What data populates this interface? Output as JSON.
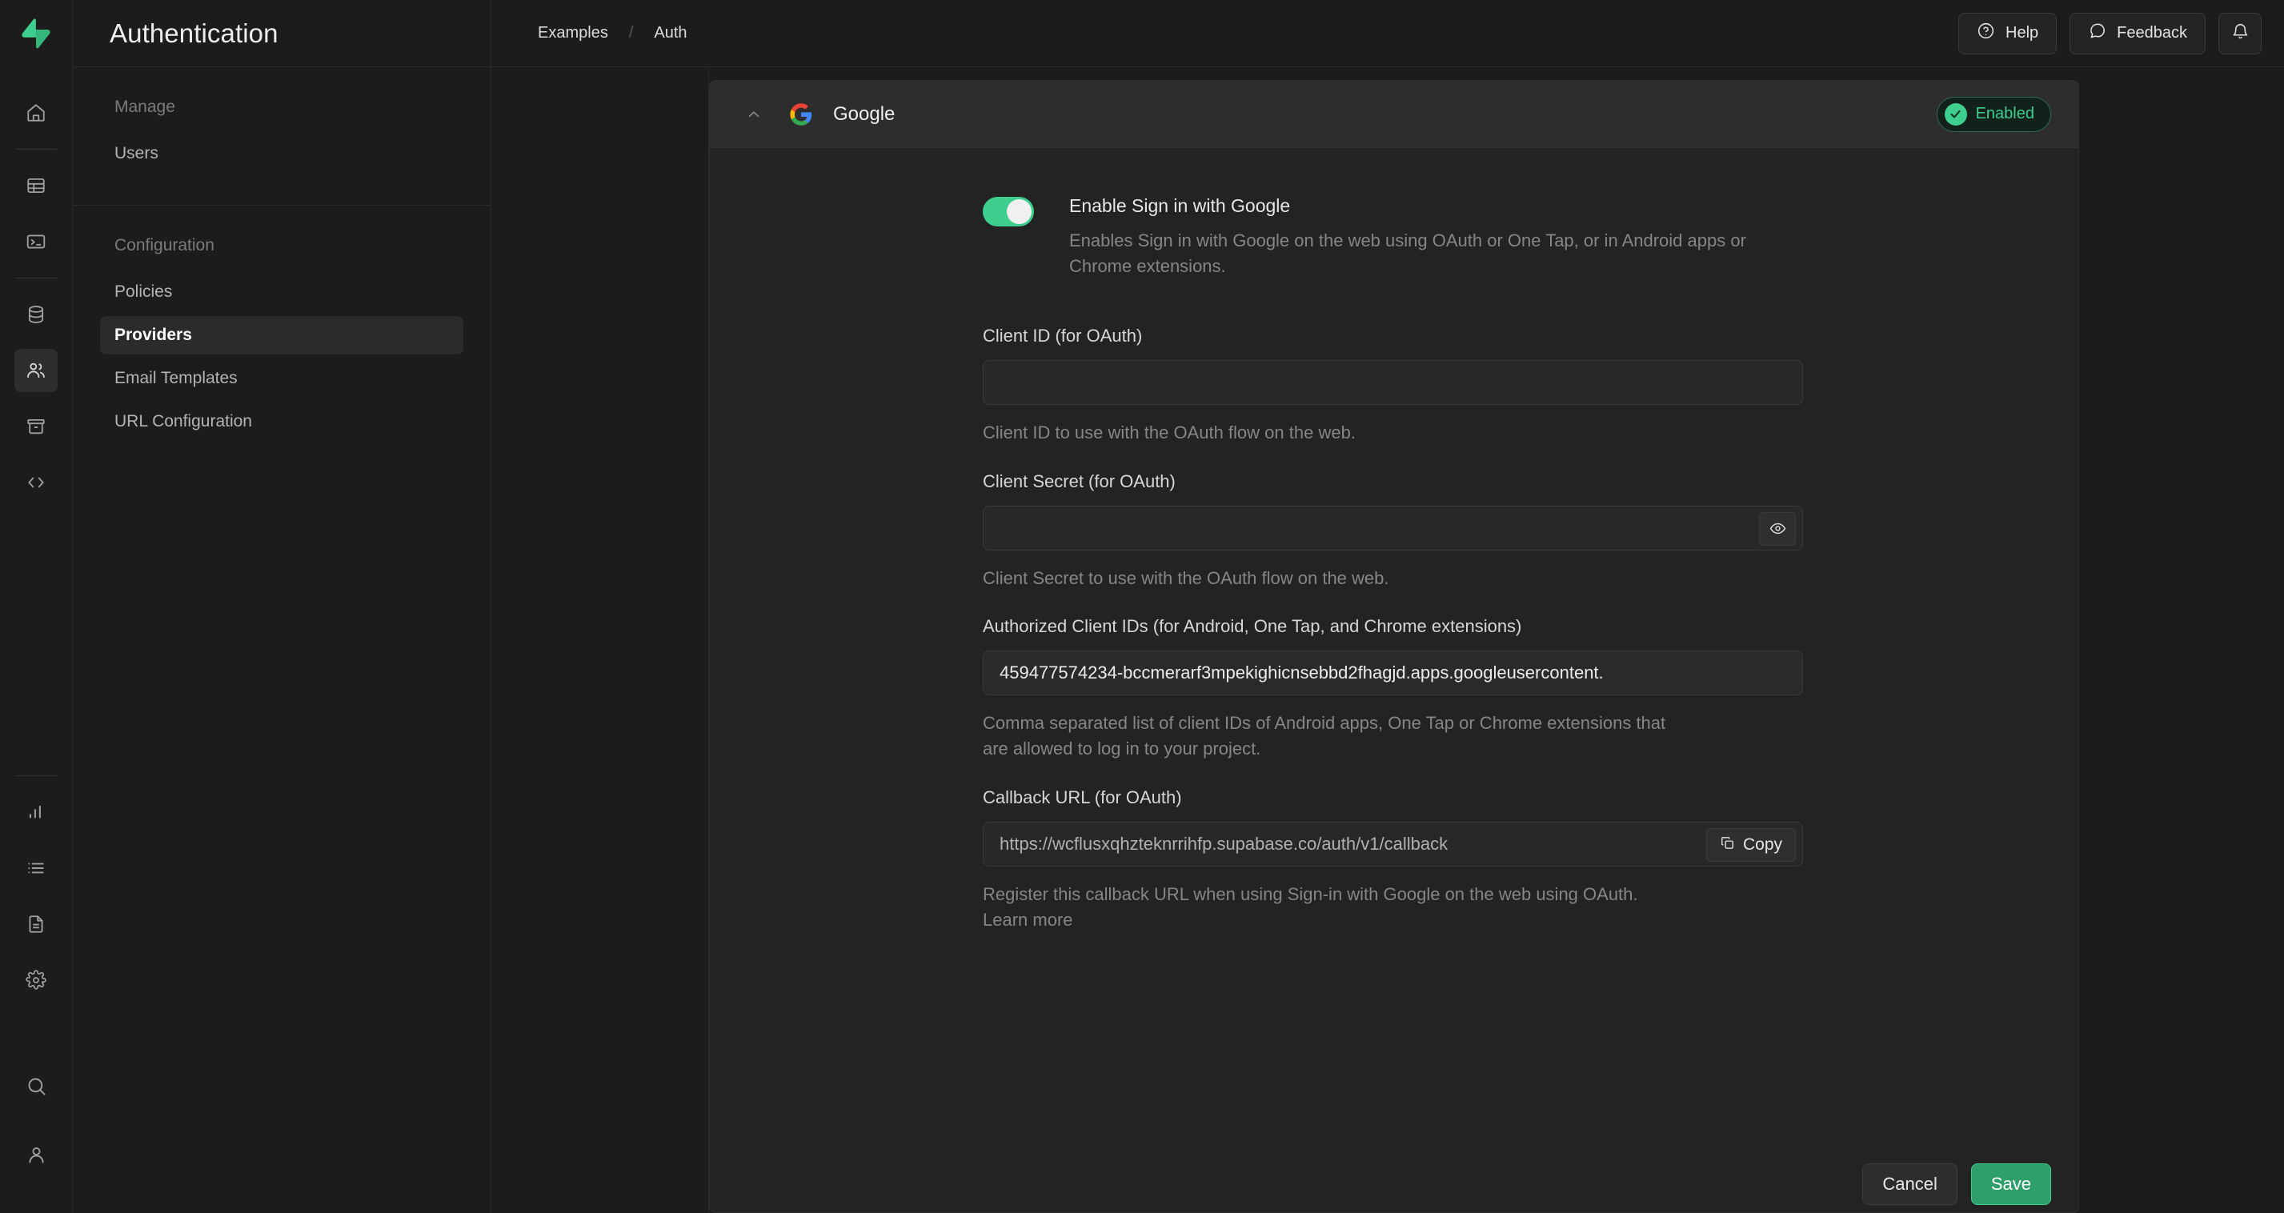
{
  "brand": {
    "logo_name": "supabase-logo",
    "accent": "#3ecf8e"
  },
  "rail": {
    "items": [
      {
        "name": "home-icon",
        "label": "Home"
      },
      {
        "name": "table-editor-icon",
        "label": "Table Editor"
      },
      {
        "name": "sql-editor-icon",
        "label": "SQL Editor"
      },
      {
        "name": "database-icon",
        "label": "Database"
      },
      {
        "name": "authentication-icon",
        "label": "Authentication"
      },
      {
        "name": "storage-icon",
        "label": "Storage"
      },
      {
        "name": "edge-functions-icon",
        "label": "Edge Functions"
      }
    ],
    "bottom_items": [
      {
        "name": "reports-icon",
        "label": "Reports"
      },
      {
        "name": "logs-icon",
        "label": "Logs"
      },
      {
        "name": "api-docs-icon",
        "label": "API Docs"
      },
      {
        "name": "settings-icon",
        "label": "Project Settings"
      },
      {
        "name": "search-icon",
        "label": "Search"
      },
      {
        "name": "account-icon",
        "label": "Account"
      }
    ]
  },
  "sidebar": {
    "title": "Authentication",
    "groups": [
      {
        "label": "Manage",
        "items": [
          {
            "label": "Users",
            "active": false
          }
        ]
      },
      {
        "label": "Configuration",
        "items": [
          {
            "label": "Policies",
            "active": false
          },
          {
            "label": "Providers",
            "active": true
          },
          {
            "label": "Email Templates",
            "active": false
          },
          {
            "label": "URL Configuration",
            "active": false
          }
        ]
      }
    ]
  },
  "topbar": {
    "breadcrumb": [
      {
        "label": "Examples"
      },
      {
        "label": "Auth"
      }
    ],
    "breadcrumb_separator": "/",
    "help_label": "Help",
    "help_icon": "question-circle-icon",
    "feedback_label": "Feedback",
    "feedback_icon": "chat-bubble-icon",
    "notifications_icon": "bell-icon"
  },
  "provider": {
    "collapse_icon": "chevron-up-icon",
    "logo_icon": "google-logo-icon",
    "name": "Google",
    "status_badge": {
      "label": "Enabled",
      "icon": "check-circle-icon",
      "color": "#3ecf8e"
    },
    "toggle": {
      "state": "on",
      "label": "Enable Sign in with Google",
      "description": "Enables Sign in with Google on the web using OAuth or One Tap, or in Android apps or Chrome extensions."
    },
    "fields": [
      {
        "label": "Client ID (for OAuth)",
        "value": "",
        "placeholder": "",
        "help": "Client ID to use with the OAuth flow on the web."
      },
      {
        "label": "Client Secret (for OAuth)",
        "value": "",
        "placeholder": "",
        "help": "Client Secret to use with the OAuth flow on the web.",
        "action_icon": "eye-icon"
      },
      {
        "label": "Authorized Client IDs (for Android, One Tap, and Chrome extensions)",
        "value": "459477574234-bccmerarf3mpekighicnsebbd2fhagjd.apps.googleusercontent.",
        "placeholder": "",
        "help": "Comma separated list of client IDs of Android apps, One Tap or Chrome extensions that are allowed to log in to your project."
      },
      {
        "label": "Callback URL (for OAuth)",
        "value": "https://wcflusxqhzteknrrihfp.supabase.co/auth/v1/callback",
        "placeholder": "",
        "help": "Register this callback URL when using Sign-in with Google on the web using OAuth. Learn more",
        "action_label": "Copy",
        "action_icon": "copy-icon"
      }
    ],
    "footer": {
      "cancel_label": "Cancel",
      "save_label": "Save"
    }
  }
}
